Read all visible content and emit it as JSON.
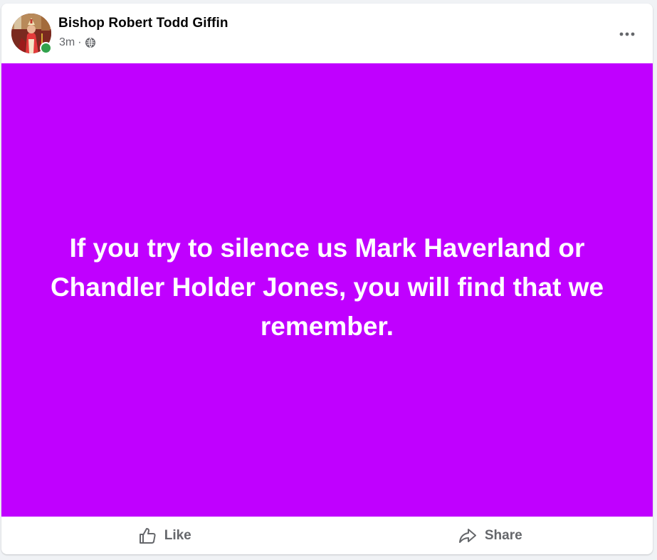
{
  "post": {
    "author": "Bishop Robert Todd Giffin",
    "timestamp": "3m",
    "separator": "·",
    "audience_icon": "globe-icon",
    "more_icon": "more-horizontal-icon",
    "author_online": true,
    "text": "If you try to silence us Mark Haverland or Chandler Holder Jones, you will find that we remember.",
    "background_color": "#c000ff",
    "text_color": "#ffffff"
  },
  "actions": {
    "like_label": "Like",
    "like_icon": "thumbs-up-icon",
    "share_label": "Share",
    "share_icon": "share-arrow-icon"
  },
  "colors": {
    "online_status": "#31a24c",
    "secondary_text": "#65676b"
  }
}
